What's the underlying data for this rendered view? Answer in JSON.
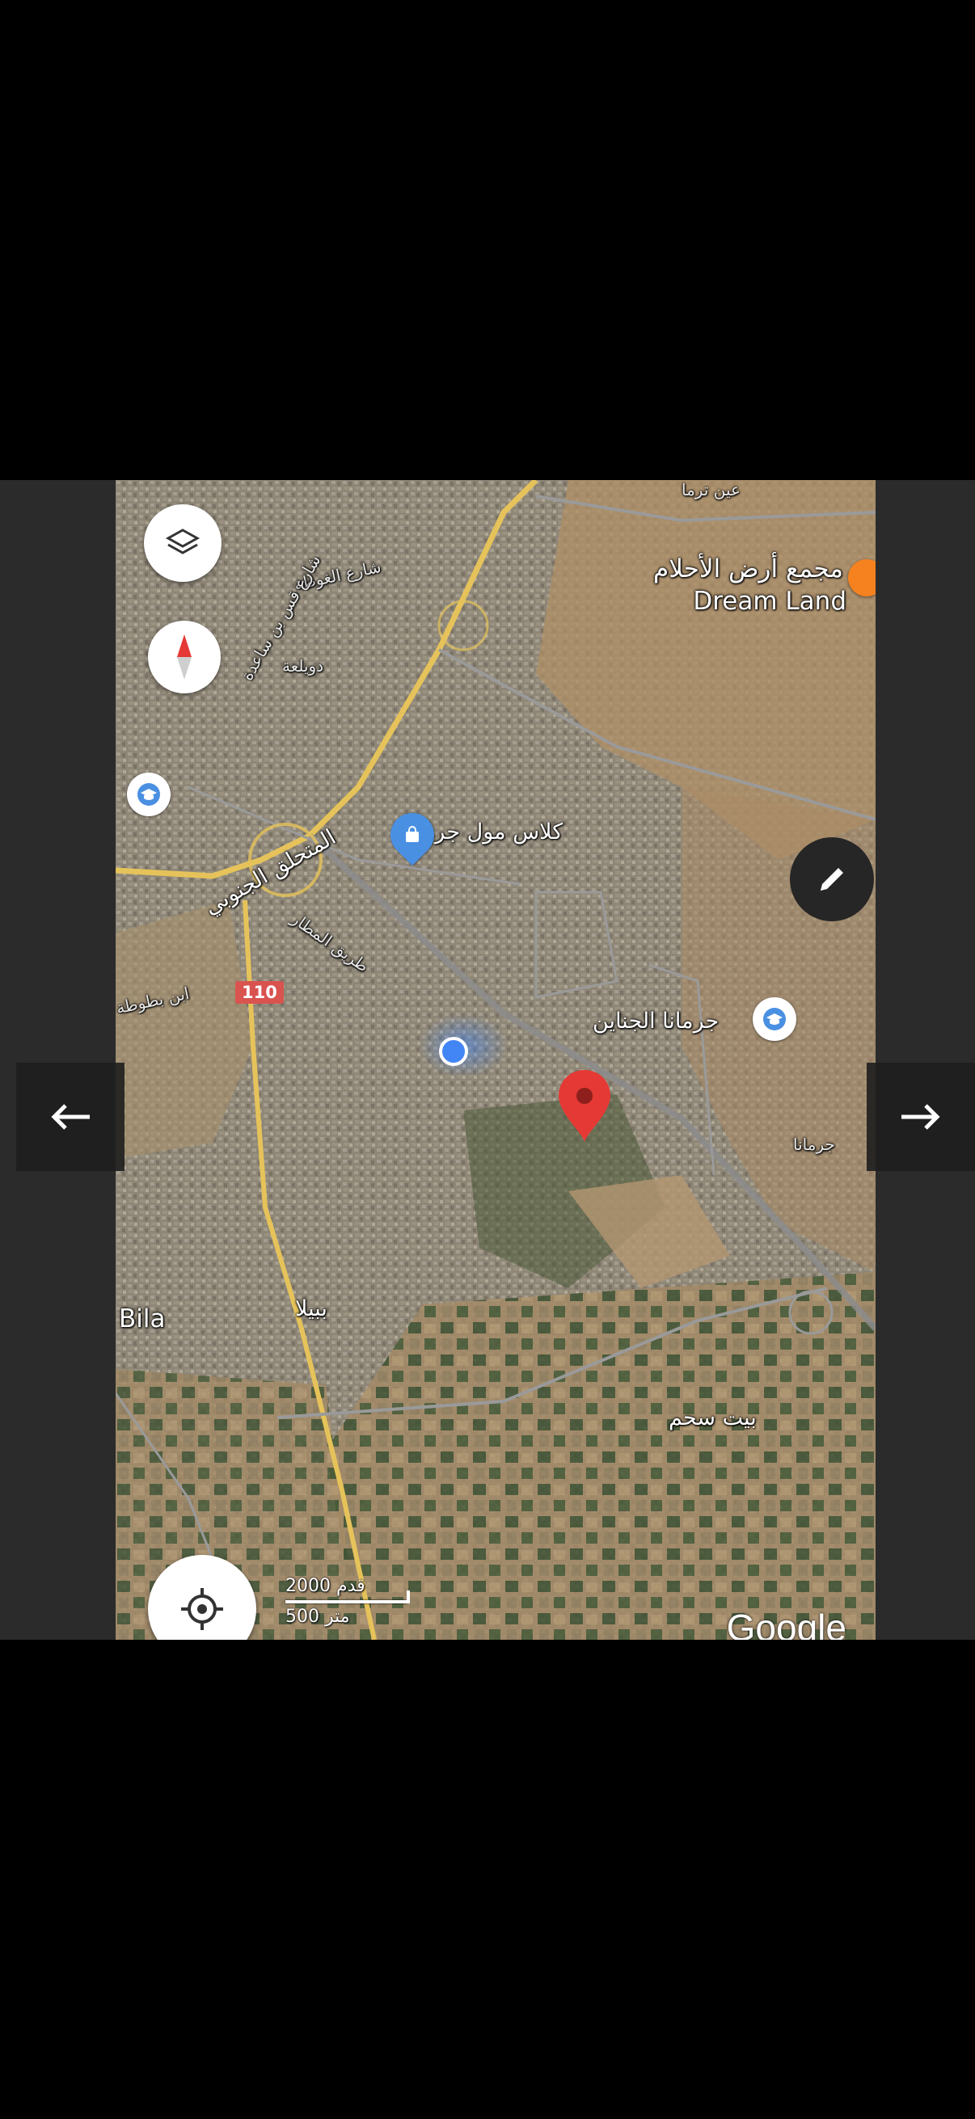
{
  "map": {
    "labels": [
      {
        "key": "dream_land_ar",
        "text": "مجمع أرض الأحلام"
      },
      {
        "key": "dream_land_en",
        "text": "Dream Land"
      },
      {
        "key": "ayn_tarma",
        "text": "عين ترما"
      },
      {
        "key": "shari_ghouta",
        "text": "شارع الغوطة"
      },
      {
        "key": "duwaylaa",
        "text": "دويلعة"
      },
      {
        "key": "shari_qass",
        "text": "شارع قس بن ساعدة"
      },
      {
        "key": "mutahaliq",
        "text": "المتحلق الجنوبي"
      },
      {
        "key": "tariq_matar",
        "text": "طريق المطار"
      },
      {
        "key": "ibn_battuta",
        "text": "ابن بطوطة"
      },
      {
        "key": "class_mall",
        "text": "كلاس مول جرمانا"
      },
      {
        "key": "jaramana_jinayn",
        "text": "جرمانا الجناين"
      },
      {
        "key": "jaramana",
        "text": "جرمانا"
      },
      {
        "key": "bila_en",
        "text": "Bila"
      },
      {
        "key": "bibila_ar",
        "text": "ببيلا"
      },
      {
        "key": "beit_sahm",
        "text": "بيت سحم"
      }
    ],
    "route_shield": "110",
    "scale": {
      "feet": "2000 قدم",
      "meters": "500 متر"
    },
    "attribution": "Google"
  },
  "icons": {
    "layers": "layers-icon",
    "compass": "compass-icon",
    "edit": "pencil-icon",
    "my_location": "crosshair-icon",
    "prev": "arrow-left-icon",
    "next": "arrow-right-icon",
    "school": "school-icon",
    "shopping": "shopping-bag-icon",
    "pin": "red-pin-icon"
  },
  "colors": {
    "pin": "#e53935",
    "location_dot": "#4285f4",
    "poi_blue": "#4a90e2",
    "orange_poi": "#f5821f",
    "road_yellow": "#e6c35a"
  }
}
